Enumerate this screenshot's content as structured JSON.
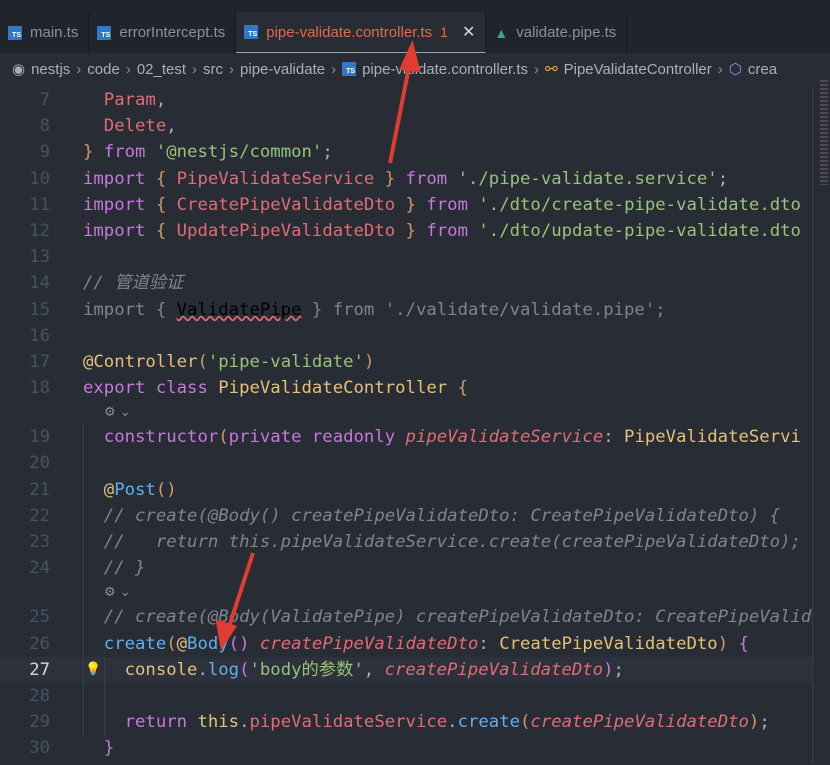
{
  "tabs": [
    {
      "label": "main.ts",
      "icon": "typescript-icon"
    },
    {
      "label": "errorIntercept.ts",
      "icon": "typescript-icon"
    },
    {
      "label": "pipe-validate.controller.ts",
      "icon": "typescript-icon",
      "badge": "1",
      "active": true
    },
    {
      "label": "validate.pipe.ts",
      "icon": "angular-icon"
    }
  ],
  "breadcrumb": [
    "nestjs",
    "code",
    "02_test",
    "src",
    "pipe-validate",
    "pipe-validate.controller.ts",
    "PipeValidateController",
    "crea"
  ],
  "editor": {
    "current_line": 27,
    "lines": [
      {
        "n": "7",
        "t": [
          [
            "v",
            "  Param"
          ],
          [
            "t",
            ","
          ]
        ]
      },
      {
        "n": "8",
        "t": [
          [
            "v",
            "  Delete"
          ],
          [
            "t",
            ","
          ]
        ]
      },
      {
        "n": "9",
        "t": [
          [
            "o",
            "}"
          ],
          [
            "k",
            " from "
          ],
          [
            "s",
            "'@nestjs/common'"
          ],
          [
            "t",
            ";"
          ]
        ]
      },
      {
        "n": "10",
        "t": [
          [
            "k",
            "import "
          ],
          [
            "o",
            "{ "
          ],
          [
            "v",
            "PipeValidateService"
          ],
          [
            "o",
            " }"
          ],
          [
            "k",
            " from "
          ],
          [
            "s",
            "'./pipe-validate.service'"
          ],
          [
            "t",
            ";"
          ]
        ]
      },
      {
        "n": "11",
        "t": [
          [
            "k",
            "import "
          ],
          [
            "o",
            "{ "
          ],
          [
            "v",
            "CreatePipeValidateDto"
          ],
          [
            "o",
            " }"
          ],
          [
            "k",
            " from "
          ],
          [
            "s",
            "'./dto/create-pipe-validate.dto"
          ]
        ]
      },
      {
        "n": "12",
        "t": [
          [
            "k",
            "import "
          ],
          [
            "o",
            "{ "
          ],
          [
            "v",
            "UpdatePipeValidateDto"
          ],
          [
            "o",
            " }"
          ],
          [
            "k",
            " from "
          ],
          [
            "s",
            "'./dto/update-pipe-validate.dto"
          ]
        ]
      },
      {
        "n": "13",
        "t": []
      },
      {
        "n": "14",
        "t": [
          [
            "cm",
            "// 管道验证"
          ]
        ]
      },
      {
        "n": "15",
        "dim": true,
        "t": [
          [
            "d",
            "import { "
          ],
          [
            "squig",
            "ValidatePipe"
          ],
          [
            "d",
            " } from './validate/validate.pipe';"
          ]
        ]
      },
      {
        "n": "16",
        "t": []
      },
      {
        "n": "17",
        "t": [
          [
            "c",
            "@Controller"
          ],
          [
            "o",
            "("
          ],
          [
            "s",
            "'pipe-validate'"
          ],
          [
            "o",
            ")"
          ]
        ]
      },
      {
        "n": "18",
        "t": [
          [
            "k",
            "export class "
          ],
          [
            "c",
            "PipeValidateController "
          ],
          [
            "o",
            "{"
          ]
        ],
        "lens_after": true
      },
      {
        "n": "19",
        "t": [
          [
            "k",
            "  constructor"
          ],
          [
            "o",
            "("
          ],
          [
            "k",
            "private readonly "
          ],
          [
            "p",
            "pipeValidateService"
          ],
          [
            "t",
            ": "
          ],
          [
            "c",
            "PipeValidateServi"
          ]
        ]
      },
      {
        "n": "20",
        "t": []
      },
      {
        "n": "21",
        "t": [
          [
            "c",
            "  @"
          ],
          [
            "f",
            "Post"
          ],
          [
            "o",
            "()"
          ]
        ]
      },
      {
        "n": "22",
        "t": [
          [
            "cm",
            "  // create(@Body() createPipeValidateDto: CreatePipeValidateDto) {"
          ]
        ]
      },
      {
        "n": "23",
        "t": [
          [
            "cm",
            "  //   return this.pipeValidateService.create(createPipeValidateDto);"
          ]
        ]
      },
      {
        "n": "24",
        "t": [
          [
            "cm",
            "  // }"
          ]
        ],
        "lens_after": true
      },
      {
        "n": "25",
        "t": [
          [
            "cm",
            "  // create(@Body(ValidatePipe) createPipeValidateDto: CreatePipeValid"
          ]
        ]
      },
      {
        "n": "26",
        "t": [
          [
            "f",
            "  create"
          ],
          [
            "o",
            "("
          ],
          [
            "c",
            "@"
          ],
          [
            "f",
            "Body"
          ],
          [
            "k",
            "()"
          ],
          [
            "p",
            " createPipeValidateDto"
          ],
          [
            "t",
            ": "
          ],
          [
            "c",
            "CreatePipeValidateDto"
          ],
          [
            "o",
            ")"
          ],
          [
            "k",
            " {"
          ]
        ]
      },
      {
        "n": "27",
        "t": [
          [
            "c",
            "    console"
          ],
          [
            "t",
            "."
          ],
          [
            "f",
            "log"
          ],
          [
            "k",
            "("
          ],
          [
            "s",
            "'body的参数'"
          ],
          [
            "t",
            ", "
          ],
          [
            "p",
            "createPipeValidateDto"
          ],
          [
            "k",
            ")"
          ],
          [
            "t",
            ";"
          ]
        ]
      },
      {
        "n": "28",
        "t": []
      },
      {
        "n": "29",
        "t": [
          [
            "k",
            "    return "
          ],
          [
            "c",
            "this"
          ],
          [
            "t",
            "."
          ],
          [
            "v",
            "pipeValidateService"
          ],
          [
            "t",
            "."
          ],
          [
            "f",
            "create"
          ],
          [
            "o",
            "("
          ],
          [
            "p",
            "createPipeValidateDto"
          ],
          [
            "o",
            ")"
          ],
          [
            "t",
            ";"
          ]
        ]
      },
      {
        "n": "30",
        "t": [
          [
            "k",
            "  }"
          ]
        ]
      }
    ]
  },
  "colors": {
    "background": "#282c34",
    "active_tab_text": "#e06c4a",
    "annotation_arrows": "#e03c31"
  }
}
